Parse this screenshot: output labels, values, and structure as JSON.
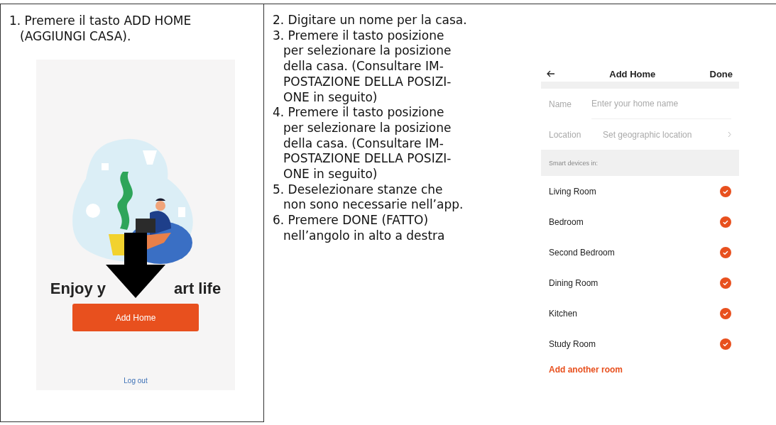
{
  "left_cell": {
    "step": "1. Premere il tasto ADD HOME\n(AGGIUNGI CASA).",
    "welcome_screen": {
      "title_parts": [
        "Enjoy y",
        "art life"
      ],
      "button": "Add Home",
      "logout": "Log out"
    }
  },
  "right_cell": {
    "steps": [
      "2. Digitare un nome per la casa.",
      "3. Premere il tasto posizione\nper selezionare la posizione\ndella casa. (Consultare IM-\nPOSTAZIONE DELLA POSIZI-\nONE in seguito)",
      "4. Premere il tasto posizione\nper selezionare la posizione\ndella casa. (Consultare IM-\nPOSTAZIONE DELLA POSIZI-\nONE in seguito)",
      "5. Deselezionare stanze che\nnon sono necessarie nell’app.",
      "6. Premere DONE (FATTO)\nnell’angolo in alto a destra"
    ],
    "add_home_screen": {
      "title": "Add Home",
      "done": "Done",
      "name": {
        "label": "Name",
        "placeholder": "Enter your home name"
      },
      "location": {
        "label": "Location",
        "value": "Set geographic location"
      },
      "section": "Smart devices in:",
      "rooms": [
        {
          "name": "Living Room",
          "checked": true
        },
        {
          "name": "Bedroom",
          "checked": true
        },
        {
          "name": "Second Bedroom",
          "checked": true
        },
        {
          "name": "Dining Room",
          "checked": true
        },
        {
          "name": "Kitchen",
          "checked": true
        },
        {
          "name": "Study Room",
          "checked": true
        }
      ],
      "add_room": "Add another room"
    }
  }
}
